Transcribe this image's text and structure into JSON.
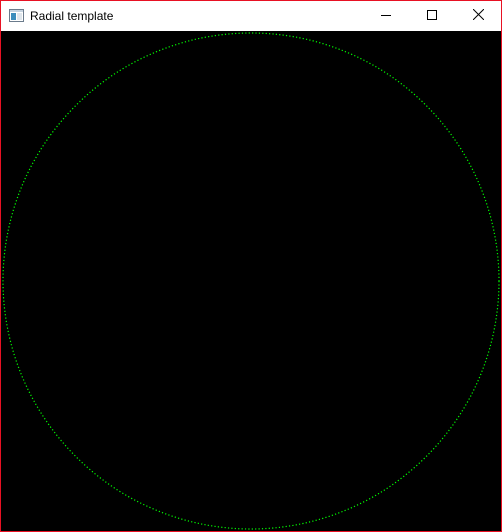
{
  "window": {
    "title": "Radial template",
    "border_color": "#e81123"
  },
  "titlebar": {
    "icon": "app-window-icon",
    "buttons": [
      {
        "name": "minimize",
        "icon": "minimize-icon"
      },
      {
        "name": "maximize",
        "icon": "maximize-icon"
      },
      {
        "name": "close",
        "icon": "close-icon"
      }
    ]
  },
  "canvas": {
    "background": "#000000",
    "circle_color": "#00ff00",
    "circle_style": "dotted"
  }
}
